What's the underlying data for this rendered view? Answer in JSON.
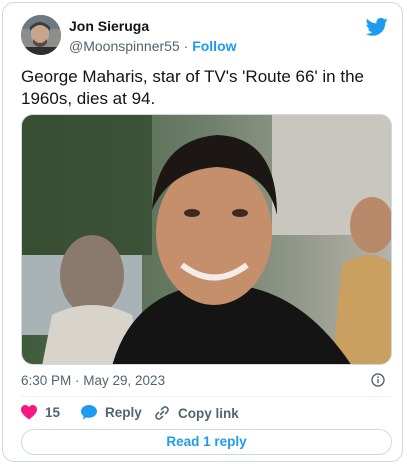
{
  "author": {
    "name": "Jon Sieruga",
    "handle": "@Moonspinner55",
    "separator": "·",
    "follow_label": "Follow"
  },
  "tweet": {
    "text": "George Maharis, star of TV's 'Route 66' in the 1960s, dies at 94.",
    "timestamp": "6:30 PM · May 29, 2023"
  },
  "actions": {
    "likes": "15",
    "reply_label": "Reply",
    "copy_link_label": "Copy link"
  },
  "read_replies_label": "Read 1 reply",
  "colors": {
    "accent": "#1d9bf0",
    "like": "#f91880",
    "text": "#0f1419",
    "muted": "#536471"
  },
  "icons": [
    "twitter-bird-icon",
    "info-icon",
    "heart-icon",
    "reply-bubble-icon",
    "link-icon"
  ]
}
